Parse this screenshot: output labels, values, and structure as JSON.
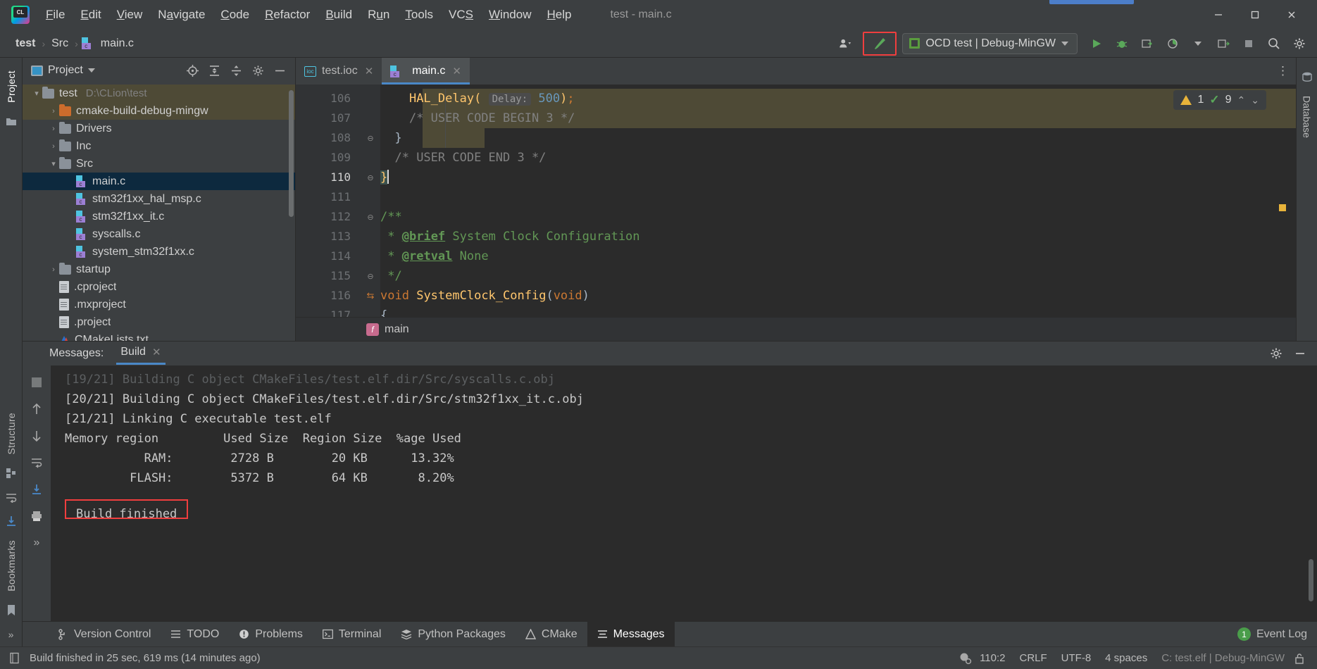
{
  "window": {
    "title": "test - main.c",
    "minimize_label": "—",
    "maximize_label": "☐",
    "close_label": "✕"
  },
  "menubar": {
    "items": [
      {
        "label": "File",
        "mnemonic": "F"
      },
      {
        "label": "Edit",
        "mnemonic": "E"
      },
      {
        "label": "View",
        "mnemonic": "V"
      },
      {
        "label": "Navigate",
        "mnemonic": "a"
      },
      {
        "label": "Code",
        "mnemonic": "C"
      },
      {
        "label": "Refactor",
        "mnemonic": "R"
      },
      {
        "label": "Build",
        "mnemonic": "B"
      },
      {
        "label": "Run",
        "mnemonic": "u"
      },
      {
        "label": "Tools",
        "mnemonic": "T"
      },
      {
        "label": "VCS",
        "mnemonic": "S"
      },
      {
        "label": "Window",
        "mnemonic": "W"
      },
      {
        "label": "Help",
        "mnemonic": "H"
      }
    ]
  },
  "navbar": {
    "breadcrumbs": [
      "test",
      "Src",
      "main.c"
    ],
    "separator": "›",
    "run_config": "OCD test | Debug-MinGW",
    "icons": {
      "account": "account-icon",
      "build_hammer": "build-hammer-icon",
      "run": "run-icon",
      "debug": "debug-icon",
      "attach": "attach-icon",
      "coverage": "coverage-icon",
      "profile": "profile-icon",
      "stop": "stop-icon",
      "search": "search-icon",
      "settings": "settings-icon"
    }
  },
  "left_bar": {
    "project_tab": "Project",
    "structure_tab": "Structure",
    "bookmarks_tab": "Bookmarks"
  },
  "right_bar": {
    "database_tab": "Database"
  },
  "project_panel": {
    "title": "Project",
    "header_icons": [
      "locate-icon",
      "expand-all-icon",
      "collapse-all-icon",
      "gear-icon",
      "hide-icon"
    ],
    "tree": [
      {
        "label": "test",
        "detail": "D:\\CLion\\test",
        "depth": 0,
        "type": "folder",
        "arrow": "▾",
        "state": "hl"
      },
      {
        "label": "cmake-build-debug-mingw",
        "detail": "",
        "depth": 1,
        "type": "folder-orange",
        "arrow": "›",
        "state": "hl"
      },
      {
        "label": "Drivers",
        "detail": "",
        "depth": 1,
        "type": "folder",
        "arrow": "›",
        "state": ""
      },
      {
        "label": "Inc",
        "detail": "",
        "depth": 1,
        "type": "folder",
        "arrow": "›",
        "state": ""
      },
      {
        "label": "Src",
        "detail": "",
        "depth": 1,
        "type": "folder",
        "arrow": "▾",
        "state": ""
      },
      {
        "label": "main.c",
        "detail": "",
        "depth": 2,
        "type": "cfile",
        "arrow": "",
        "state": "sel"
      },
      {
        "label": "stm32f1xx_hal_msp.c",
        "detail": "",
        "depth": 2,
        "type": "cfile",
        "arrow": "",
        "state": ""
      },
      {
        "label": "stm32f1xx_it.c",
        "detail": "",
        "depth": 2,
        "type": "cfile",
        "arrow": "",
        "state": ""
      },
      {
        "label": "syscalls.c",
        "detail": "",
        "depth": 2,
        "type": "cfile",
        "arrow": "",
        "state": ""
      },
      {
        "label": "system_stm32f1xx.c",
        "detail": "",
        "depth": 2,
        "type": "cfile",
        "arrow": "",
        "state": ""
      },
      {
        "label": "startup",
        "detail": "",
        "depth": 1,
        "type": "folder",
        "arrow": "›",
        "state": ""
      },
      {
        "label": ".cproject",
        "detail": "",
        "depth": 1,
        "type": "doc",
        "arrow": "",
        "state": ""
      },
      {
        "label": ".mxproject",
        "detail": "",
        "depth": 1,
        "type": "doc",
        "arrow": "",
        "state": ""
      },
      {
        "label": ".project",
        "detail": "",
        "depth": 1,
        "type": "doc",
        "arrow": "",
        "state": ""
      },
      {
        "label": "CMakeLists.txt",
        "detail": "",
        "depth": 1,
        "type": "cmake",
        "arrow": "",
        "state": ""
      }
    ]
  },
  "editor": {
    "tabs": [
      {
        "label": "test.ioc",
        "icon": "ioc-file-icon",
        "active": false
      },
      {
        "label": "main.c",
        "icon": "c-file-icon",
        "active": true
      }
    ],
    "inspection": {
      "warning_count": "1",
      "check_count": "9",
      "up": "⌃",
      "down": "⌄"
    },
    "breadcrumb": {
      "icon": "function-icon",
      "label": "main"
    },
    "lines": [
      {
        "num": "106",
        "text": "HAL_Delay( Delay: 500);"
      },
      {
        "num": "107",
        "text": "/* USER CODE BEGIN 3 */"
      },
      {
        "num": "108",
        "text": "}"
      },
      {
        "num": "109",
        "text": "/* USER CODE END 3 */"
      },
      {
        "num": "110",
        "text": "}"
      },
      {
        "num": "111",
        "text": ""
      },
      {
        "num": "112",
        "text": "/**"
      },
      {
        "num": "113",
        "text": "* @brief System Clock Configuration"
      },
      {
        "num": "114",
        "text": "* @retval None"
      },
      {
        "num": "115",
        "text": "*/"
      },
      {
        "num": "116",
        "text": "void SystemClock_Config(void)"
      },
      {
        "num": "117",
        "text": "{"
      }
    ],
    "tokens": {
      "hal_delay": "HAL_Delay(",
      "delay_hint": "Delay:",
      "delay_value": "500",
      "close_paren_semi": ");",
      "begin3": "/* USER CODE BEGIN 3 */",
      "end3": "/* USER CODE END 3 */",
      "brace_close": "}",
      "doc_open": "/**",
      "star": "*",
      "tag_brief": "@brief",
      "brief_text": "System Clock Configuration",
      "tag_retval": "@retval",
      "retval_text": "None",
      "doc_close": "*/",
      "kw_void": "void",
      "fn_name": "SystemClock_Config",
      "paren_void": "(void)",
      "brace_open": "{"
    }
  },
  "messages_panel": {
    "label": "Messages:",
    "tab": "Build",
    "close": "✕",
    "lines": [
      "[19/21] Building C object CMakeFiles/test.elf.dir/Src/syscalls.c.obj",
      "[20/21] Building C object CMakeFiles/test.elf.dir/Src/stm32f1xx_it.c.obj",
      "[21/21] Linking C executable test.elf",
      "Memory region         Used Size  Region Size  %age Used",
      "           RAM:        2728 B        20 KB      13.32%",
      "         FLASH:        5372 B        64 KB       8.20%"
    ],
    "build_finished": "Build finished",
    "sidebar_icons": [
      "stop-icon",
      "scroll-up-icon",
      "scroll-down-icon",
      "soft-wrap-icon",
      "scroll-to-end-icon",
      "print-icon",
      "expand-icon"
    ],
    "header_icons": [
      "gear-icon",
      "hide-icon"
    ]
  },
  "bottom_tabs": {
    "items": [
      {
        "label": "Version Control",
        "icon": "branch-icon",
        "active": false
      },
      {
        "label": "TODO",
        "icon": "list-icon",
        "active": false
      },
      {
        "label": "Problems",
        "icon": "error-icon",
        "active": false
      },
      {
        "label": "Terminal",
        "icon": "terminal-icon",
        "active": false
      },
      {
        "label": "Python Packages",
        "icon": "packages-icon",
        "active": false
      },
      {
        "label": "CMake",
        "icon": "cmake-icon",
        "active": false
      },
      {
        "label": "Messages",
        "icon": "messages-icon",
        "active": true
      }
    ],
    "event_log": {
      "label": "Event Log",
      "badge": "1"
    }
  },
  "statusbar": {
    "message": "Build finished in 25 sec, 619 ms (14 minutes ago)",
    "caret_position": "110:2",
    "line_separator": "CRLF",
    "encoding": "UTF-8",
    "indent": "4 spaces",
    "target": "C: test.elf | Debug-MinGW",
    "icons": [
      "memory-icon",
      "lock-icon",
      "status-doc-icon"
    ]
  },
  "colors": {
    "accent_blue": "#4a88c7",
    "annotation_red": "#f03e3e",
    "selection_blue": "#0d293e",
    "highlight_olive": "#4e4a36",
    "green_run": "#5aa85a",
    "warning_yellow": "#e8b33a"
  }
}
